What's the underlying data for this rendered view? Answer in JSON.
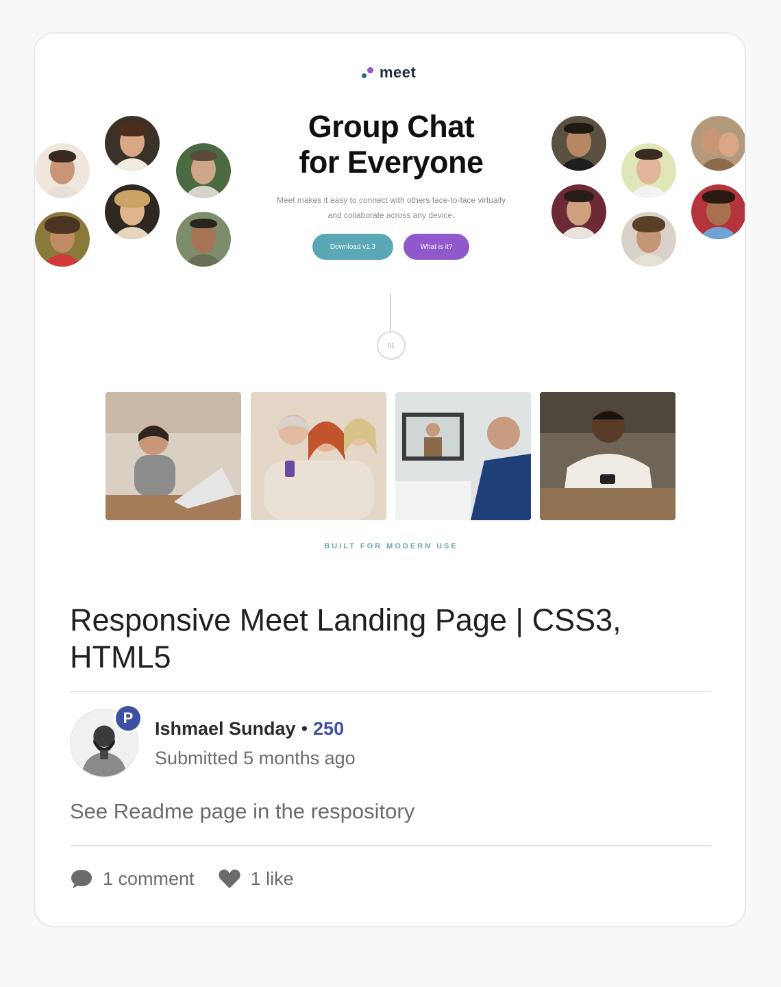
{
  "preview": {
    "logo_text": "meet",
    "hero_title_line1": "Group Chat",
    "hero_title_line2": "for Everyone",
    "hero_text": "Meet makes it easy to connect with others face-to-face virtually and collaborate across any device.",
    "download_button": "Download v1.3",
    "what_button": "What is it?",
    "step_number": "01",
    "section_label": "BUILT FOR MODERN USE",
    "colors": {
      "teal": "#5aa7b5",
      "purple": "#8f59cc"
    }
  },
  "card": {
    "title": "Responsive Meet Landing Page | CSS3, HTML5",
    "author": {
      "name": "Ishmael Sunday",
      "separator": "•",
      "score": "250",
      "badge": "P",
      "submitted": "Submitted 5 months ago"
    },
    "description": "See Readme page in the respository",
    "stats": {
      "comments": "1 comment",
      "likes": "1 like"
    }
  }
}
